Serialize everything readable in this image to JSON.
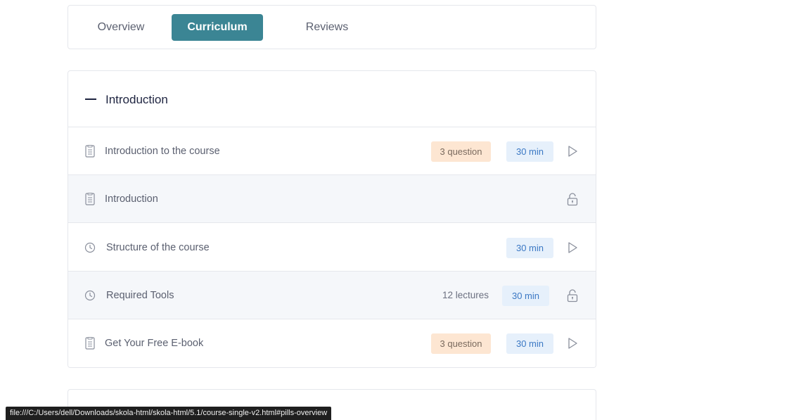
{
  "tabs": [
    {
      "label": "Overview"
    },
    {
      "label": "Curriculum",
      "active": true
    },
    {
      "label": "Reviews"
    }
  ],
  "section": {
    "title": "Introduction"
  },
  "lessons": [
    {
      "icon": "document-icon",
      "title": "Introduction to the course",
      "questions": "3 question",
      "duration": "30 min",
      "action": "play-icon"
    },
    {
      "icon": "document-icon",
      "title": "Introduction",
      "action": "lock-icon"
    },
    {
      "icon": "clock-icon",
      "title": "Structure of the course",
      "duration": "30 min",
      "action": "play-icon"
    },
    {
      "icon": "clock-icon",
      "title": "Required Tools",
      "lectures": "12 lectures",
      "duration": "30 min",
      "action": "lock-icon"
    },
    {
      "icon": "document-icon",
      "title": "Get Your Free E-book",
      "questions": "3 question",
      "duration": "30 min",
      "action": "play-icon"
    }
  ],
  "statusbar": {
    "url": "file:///C:/Users/dell/Downloads/skola-html/skola-html/5.1/course-single-v2.html#pills-overview"
  },
  "colors": {
    "accent": "#3b8594",
    "question_badge": "#fde6d2",
    "time_badge": "#e6f0fb",
    "time_text": "#3b78c4"
  }
}
